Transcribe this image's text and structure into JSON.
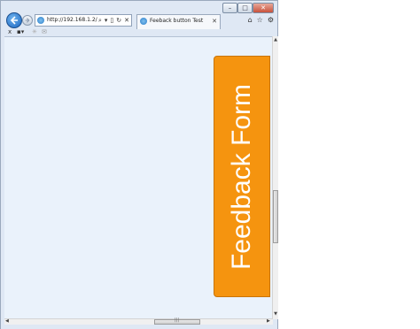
{
  "window": {
    "controls": {
      "minimize": "–",
      "maximize": "□",
      "close": "✕"
    }
  },
  "navbar": {
    "back_icon": "back-arrow-icon",
    "forward_icon": "forward-arrow-icon",
    "address_value": "http://192.168.1.2/",
    "address_icons": {
      "search": "⌕",
      "dropdown": "▾",
      "compat": "▯",
      "refresh": "↻",
      "stop": "✕"
    },
    "tab_label": "Feeback button Test",
    "tab_close": "✕",
    "tools": {
      "home": "⌂",
      "favorites": "☆",
      "settings": "⚙"
    }
  },
  "cmdbar": {
    "close": "x",
    "convert": "▪▾",
    "favorites_add": "✳",
    "mail": "✉"
  },
  "page": {
    "feedback_button_label": "Feedback Form",
    "background_color": "#eaf2fb",
    "accent_color": "#f5940f"
  },
  "scrollbars": {
    "up": "▲",
    "down": "▼",
    "left": "◀",
    "right": "▶",
    "grip": "|||"
  }
}
